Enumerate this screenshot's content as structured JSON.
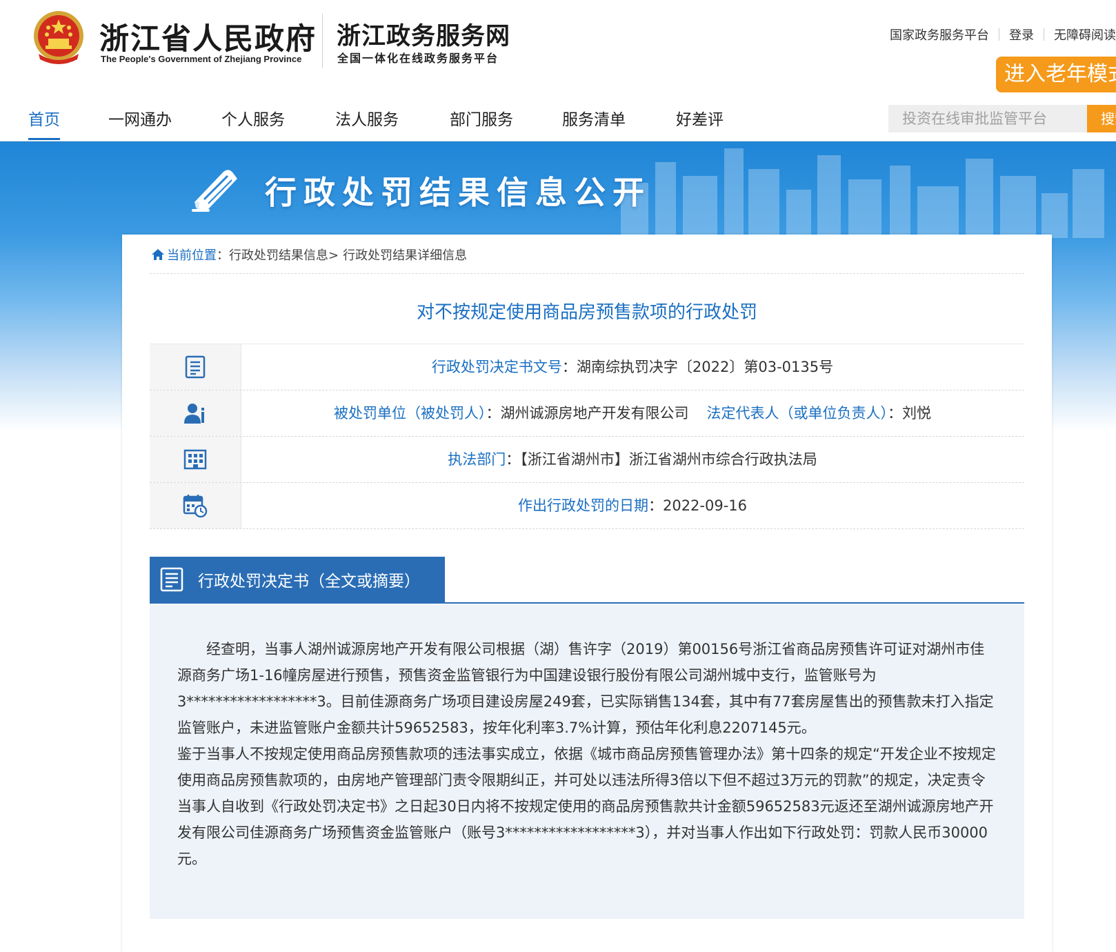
{
  "header": {
    "brand_cn": "浙江省人民政府",
    "brand_en": "The People's Government of Zhejiang Province",
    "brand2_cn": "浙江政务服务网",
    "brand2_sub": "全国一体化在线政务服务平台",
    "top_links": [
      "国家政务服务平台",
      "登录",
      "无障碍阅读"
    ],
    "elder_mode": "进入老年模式"
  },
  "nav": {
    "items": [
      "首页",
      "一网通办",
      "个人服务",
      "法人服务",
      "部门服务",
      "服务清单",
      "好差评"
    ],
    "active_index": 0,
    "search_placeholder": "投资在线审批监管平台",
    "search_button": "搜索"
  },
  "banner": {
    "title": "行政处罚结果信息公开",
    "icon": "book-icon"
  },
  "breadcrumb": {
    "home": "当前位置",
    "colon": "：",
    "level1": "行政处罚结果信息>",
    "level2": "行政处罚结果详细信息"
  },
  "document": {
    "title": "对不按规定使用商品房预售款项的行政处罚",
    "rows": [
      {
        "icon": "document-icon",
        "label": "行政处罚决定书文号",
        "value": "：湖南综执罚决字〔2022〕第03-0135号"
      },
      {
        "icon": "person-icon",
        "label": "被处罚单位（被处罚人）",
        "value": "：湖州诚源房地产开发有限公司",
        "label2": "法定代表人（或单位负责人）",
        "value2": "：刘悦"
      },
      {
        "icon": "building-icon",
        "label": "执法部门",
        "value": "：【浙江省湖州市】浙江省湖州市综合行政执法局"
      },
      {
        "icon": "calendar-icon",
        "label": "作出行政处罚的日期",
        "value": "：2022-09-16"
      }
    ],
    "section_title": "行政处罚决定书（全文或摘要）",
    "body_p1": "经查明，当事人湖州诚源房地产开发有限公司根据（湖）售许字（2019）第00156号浙江省商品房预售许可证对湖州市佳源商务广场1-16幢房屋进行预售，预售资金监管银行为中国建设银行股份有限公司湖州城中支行，监管账号为3******************3。目前佳源商务广场项目建设房屋249套，已实际销售134套，其中有77套房屋售出的预售款未打入指定监管账户，未进监管账户金额共计59652583，按年化利率3.7%计算，预估年化利息2207145元。",
    "body_p2": "鉴于当事人不按规定使用商品房预售款项的违法事实成立，依据《城市商品房预售管理办法》第十四条的规定“开发企业不按规定使用商品房预售款项的，由房地产管理部门责令限期纠正，并可处以违法所得3倍以下但不超过3万元的罚款”的规定，决定责令当事人自收到《行政处罚决定书》之日起30日内将不按规定使用的商品房预售款共计金额59652583元返还至湖州诚源房地产开发有限公司佳源商务广场预售资金监管账户（账号3******************3），并对当事人作出如下行政处罚：罚款人民币30000元。"
  },
  "colors": {
    "accent_blue": "#1a6fc2",
    "section_blue": "#2a6db5",
    "orange": "#f59a1b"
  }
}
